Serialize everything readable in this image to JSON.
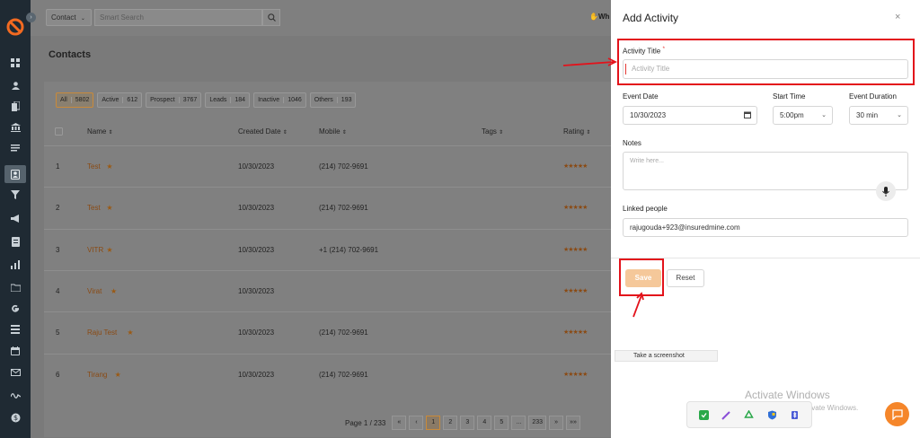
{
  "topbar": {
    "module": "Contact",
    "search_placeholder": "Smart Search",
    "user_badge": "Wh"
  },
  "page": {
    "title": "Contacts"
  },
  "filters": [
    {
      "label": "All",
      "count": "5802",
      "active": true
    },
    {
      "label": "Active",
      "count": "612"
    },
    {
      "label": "Prospect",
      "count": "3767"
    },
    {
      "label": "Leads",
      "count": "184"
    },
    {
      "label": "Inactive",
      "count": "1046"
    },
    {
      "label": "Others",
      "count": "193"
    }
  ],
  "table": {
    "headers": {
      "name": "Name",
      "created": "Created Date",
      "mobile": "Mobile",
      "tags": "Tags",
      "rating": "Rating"
    },
    "rows": [
      {
        "num": "1",
        "name": "Test",
        "created": "10/30/2023",
        "mobile": "(214) 702-9691",
        "stars": "★★★★★"
      },
      {
        "num": "2",
        "name": "Test",
        "created": "10/30/2023",
        "mobile": "(214) 702-9691",
        "stars": "★★★★★"
      },
      {
        "num": "3",
        "name": "VITR",
        "created": "10/30/2023",
        "mobile": "+1 (214) 702-9691",
        "stars": "★★★★★"
      },
      {
        "num": "4",
        "name": "Virat",
        "created": "10/30/2023",
        "mobile": "",
        "stars": "★★★★★"
      },
      {
        "num": "5",
        "name": "Raju Test",
        "created": "10/30/2023",
        "mobile": "(214) 702-9691",
        "stars": "★★★★★"
      },
      {
        "num": "6",
        "name": "Tirang",
        "created": "10/30/2023",
        "mobile": "(214) 702-9691",
        "stars": "★★★★★"
      }
    ]
  },
  "pagination": {
    "label": "Page 1 / 233",
    "first": "«",
    "prev": "‹",
    "pages": [
      "1",
      "2",
      "3",
      "4",
      "5",
      "...",
      "233"
    ],
    "next": "»",
    "last": "»»"
  },
  "drawer": {
    "title": "Add Activity",
    "close": "×",
    "activity_title_label": "Activity Title",
    "required_mark": "*",
    "activity_title_placeholder": "Activity Title",
    "event_date_label": "Event Date",
    "event_date_value": "10/30/2023",
    "start_time_label": "Start Time",
    "start_time_value": "5:00pm",
    "duration_label": "Event Duration",
    "duration_value": "30 min",
    "notes_label": "Notes",
    "notes_placeholder": "Write here...",
    "linked_label": "Linked people",
    "linked_value": "rajugouda+923@insuredmine.com",
    "save_label": "Save",
    "reset_label": "Reset"
  },
  "overlay": {
    "screenshot_tip": "Take a screenshot",
    "watermark_title": "Activate Windows",
    "watermark_sub": "Go to Settings to activate Windows."
  },
  "colors": {
    "accent": "#f5862a",
    "annotation_red": "#e3121b",
    "sidebar": "#1f2a33",
    "save_disabled": "#f5c89a"
  }
}
